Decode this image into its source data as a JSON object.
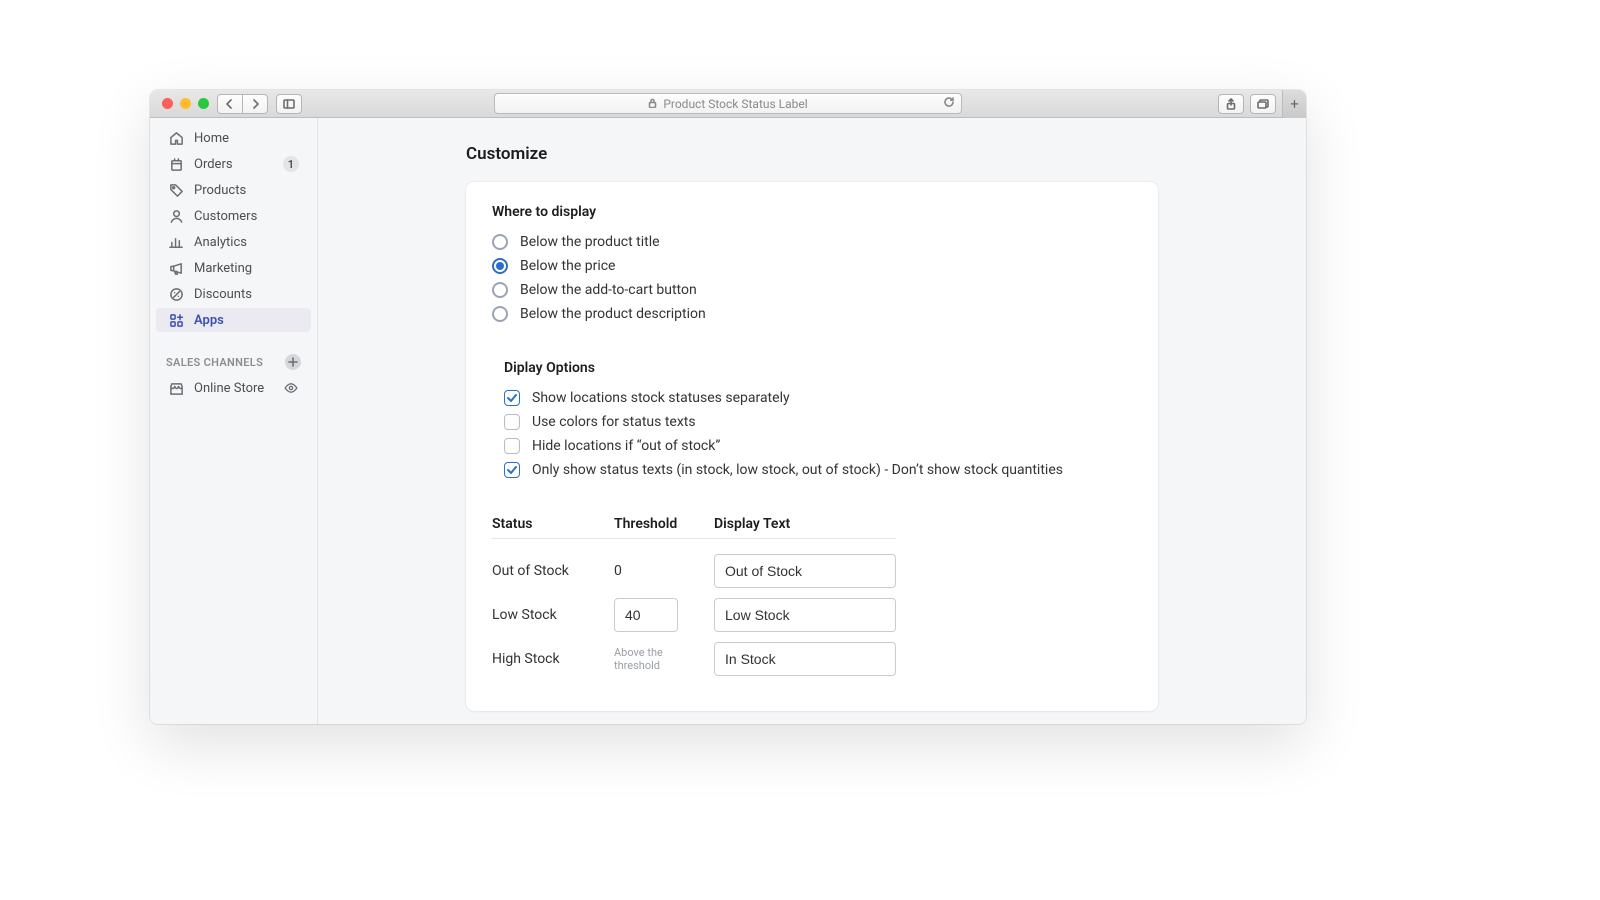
{
  "browser": {
    "page_title": "Product Stock Status Label"
  },
  "sidebar": {
    "items": [
      {
        "label": "Home"
      },
      {
        "label": "Orders",
        "badge": "1"
      },
      {
        "label": "Products"
      },
      {
        "label": "Customers"
      },
      {
        "label": "Analytics"
      },
      {
        "label": "Marketing"
      },
      {
        "label": "Discounts"
      },
      {
        "label": "Apps"
      }
    ],
    "section_title": "SALES CHANNELS",
    "channels": [
      {
        "label": "Online Store"
      }
    ]
  },
  "page": {
    "title": "Customize",
    "where_title": "Where to display",
    "where_options": [
      "Below the product title",
      "Below the price",
      "Below the add-to-cart button",
      "Below the product description"
    ],
    "where_selected": 1,
    "display_title": "Diplay Options",
    "display_options": [
      {
        "label": "Show locations stock statuses separately",
        "checked": true
      },
      {
        "label": "Use colors for status texts",
        "checked": false
      },
      {
        "label": "Hide locations if “out of stock”",
        "checked": false
      },
      {
        "label": "Only show status texts (in stock, low stock, out of stock) - Don’t show stock quantities",
        "checked": true
      }
    ],
    "table": {
      "headers": [
        "Status",
        "Threshold",
        "Display Text"
      ],
      "rows": [
        {
          "status": "Out of Stock",
          "threshold_text": "0",
          "display": "Out of Stock"
        },
        {
          "status": "Low Stock",
          "threshold_input": "40",
          "display": "Low Stock"
        },
        {
          "status": "High Stock",
          "threshold_note": "Above the threshold",
          "display": "In Stock"
        }
      ]
    }
  }
}
